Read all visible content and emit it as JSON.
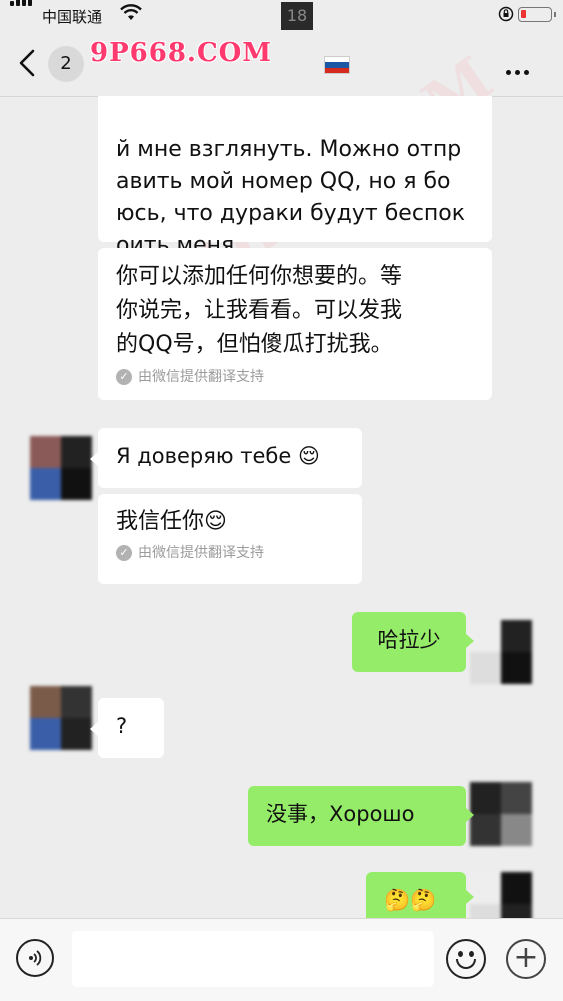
{
  "status": {
    "carrier": "中国联通",
    "time": "18"
  },
  "nav": {
    "unread_count": "2",
    "watermark": "9P668.COM",
    "flag_colors": [
      "#ffffff",
      "#1c57a5",
      "#d52b1e"
    ]
  },
  "messages": [
    {
      "side": "left",
      "text": "й мне взглянуть. Можно отпр\nавить мой  номер QQ, но я бо\nюсь, что дураки будут беспок\nоить меня."
    },
    {
      "side": "left",
      "text": "你可以添加任何你想要的。等\n你说完，让我看看。可以发我\n的QQ号，但怕傻瓜打扰我。",
      "note": "由微信提供翻译支持"
    },
    {
      "side": "left",
      "text": "Я доверяю тебе 😌"
    },
    {
      "side": "left",
      "text": "我信任你😌",
      "note": "由微信提供翻译支持"
    },
    {
      "side": "right",
      "text": "哈拉少"
    },
    {
      "side": "left",
      "text": "?"
    },
    {
      "side": "right",
      "text": "没事，Хорошо"
    },
    {
      "side": "right",
      "text": "🤔🤔"
    }
  ],
  "colors": {
    "background": "#ededed",
    "sent_bubble": "#95ec69",
    "received_bubble": "#ffffff"
  },
  "input": {
    "placeholder": ""
  }
}
